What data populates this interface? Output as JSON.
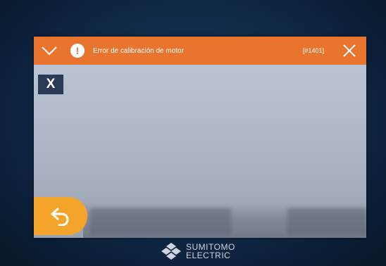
{
  "alert": {
    "message": "Error de calibración de motor",
    "code": "[#1401]",
    "collapse_icon": "chevron-down-icon",
    "warning_icon": "exclamation-icon",
    "warning_symbol": "!",
    "close_icon": "close-icon",
    "color": "#e8742e"
  },
  "dismiss_button": {
    "label": "X",
    "color": "#2b3a57"
  },
  "back_button": {
    "icon": "back-arrow-icon",
    "color": "#f2a52a"
  },
  "brand": {
    "line1": "SUMITOMO",
    "line2": "ELECTRIC",
    "logo_icon": "sumitomo-logo-icon"
  }
}
